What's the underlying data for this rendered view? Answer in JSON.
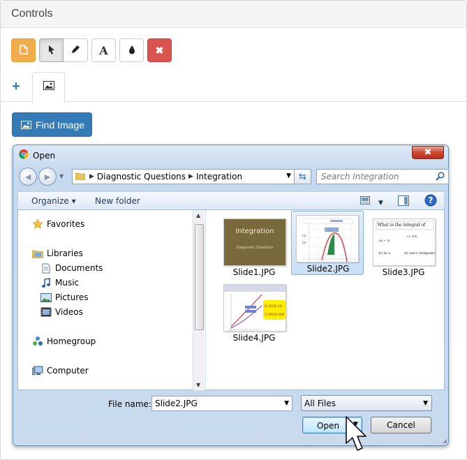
{
  "panel": {
    "title": "Controls"
  },
  "toolbar": {
    "buttons": [
      {
        "icon": "file-icon"
      },
      {
        "icon": "pointer-icon"
      },
      {
        "icon": "pencil-icon"
      },
      {
        "icon": "text-icon",
        "glyph": "A"
      },
      {
        "icon": "tint-icon"
      },
      {
        "icon": "close-icon",
        "glyph": "✖"
      }
    ],
    "colors": {
      "warning": "#f0ad4e",
      "danger": "#d9534f",
      "primary": "#337ab7"
    }
  },
  "tabs": {
    "add_glyph": "+",
    "image_tab_icon": "picture-icon"
  },
  "find_image": {
    "label": "Find Image"
  },
  "dialog": {
    "title": "Open",
    "close_glyph": "✖",
    "breadcrumb": [
      "Diagnostic Questions",
      "Integration"
    ],
    "search_placeholder": "Search Integration",
    "commands": {
      "organize": "Organize ▾",
      "new_folder": "New folder"
    },
    "nav": {
      "favorites": "Favorites",
      "libraries": "Libraries",
      "documents": "Documents",
      "music": "Music",
      "pictures": "Pictures",
      "videos": "Videos",
      "homegroup": "Homegroup",
      "computer": "Computer"
    },
    "files": [
      {
        "name": "Slide1.JPG",
        "thumb_title": "Integration",
        "thumb_sub": "Diagnostic Questions"
      },
      {
        "name": "Slide2.JPG",
        "selected": true
      },
      {
        "name": "Slide3.JPG",
        "thumb_text": "What is the integral of"
      },
      {
        "name": "Slide4.JPG"
      }
    ],
    "file_name_label": "File name:",
    "file_name_value": "Slide2.JPG",
    "file_type": "All Files",
    "open_label": "Open",
    "cancel_label": "Cancel"
  }
}
